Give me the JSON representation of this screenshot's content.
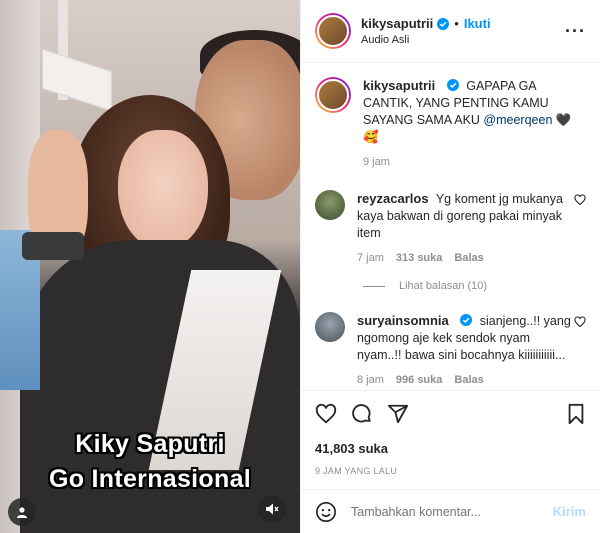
{
  "media": {
    "overlay_line1": "Kiky Saputri",
    "overlay_line2": "Go Internasional",
    "icons": [
      "user-icon",
      "mute-icon"
    ]
  },
  "header": {
    "username": "kikysaputrii",
    "dot": "•",
    "follow_label": "Ikuti",
    "audio_label": "Audio Asli",
    "more_label": "···"
  },
  "caption": {
    "username": "kikysaputrii",
    "text_before": "GAPAPA GA CANTIK, YANG PENTING KAMU SAYANG SAMA AKU",
    "mention": "@meerqeen",
    "emojis": "🖤🥰",
    "time": "9 jam"
  },
  "comments": [
    {
      "username": "reyzacarlos",
      "text": "Yg koment jg mukanya kaya bakwan di goreng pakai minyak item",
      "time": "7 jam",
      "likes": "313 suka",
      "reply_label": "Balas",
      "view_replies": "Lihat balasan (10)"
    },
    {
      "username": "suryainsomnia",
      "text": "sianjeng..!! yang ngomong aje kek sendok nyam nyam..!! bawa sini bocahnya kiiiiiiiiiii...",
      "time": "8 jam",
      "likes": "996 suka",
      "reply_label": "Balas"
    }
  ],
  "actions": {
    "likes": "41,803 suka",
    "posted": "9 JAM YANG LALU"
  },
  "add_comment": {
    "placeholder": "Tambahkan komentar...",
    "post_label": "Kirim"
  },
  "colors": {
    "accent": "#0095f6",
    "post_disabled": "#b3dbff",
    "muted": "#8e8e8e",
    "text": "#262626"
  }
}
